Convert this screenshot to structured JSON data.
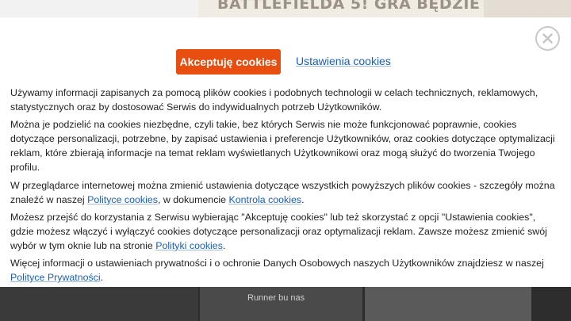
{
  "background": {
    "header_banner_text": "BATTLEFIELDA 5! GRA BĘDZIE",
    "footer_caption": "Runner bu nas"
  },
  "cookie_modal": {
    "accept_label": "Akceptuję cookies",
    "settings_label": "Ustawienia cookies",
    "close_icon": "close-icon",
    "p1": "Używamy informacji zapisanych za pomocą plików cookies i podobnych technologii w celach technicznych, reklamowych, statystycznych oraz by dostosować Serwis do indywidualnych potrzeb Użytkowników.",
    "p2": "Można je podzielić na cookies niezbędne, czyli takie, bez których Serwis nie może funkcjonować poprawnie, cookies dotyczące personalizacji, potrzebne, by zapisać ustawienia i preferencje Użytkowników, oraz cookies dotyczące optymalizacji reklam, które zbierają informacje na temat reklam wyświetlanych Użytkownikowi oraz mogą służyć do tworzenia Twojego profilu.",
    "p3": {
      "before": "W przeglądarce internetowej można zmienić ustawienia dotyczące wszystkich powyższych plików cookies - szczegóły można znaleźć w naszej ",
      "link1": "Polityce cookies",
      "middle": ", w dokumencie ",
      "link2": "Kontrola cookies",
      "after": "."
    },
    "p4": {
      "before": "Możesz przejść do korzystania z Serwisu wybierając \"Akceptuję cookies\" lub też skorzystać z opcji \"Ustawienia cookies\", gdzie możesz włączyć i wyłączyć cookies dotyczące personalizacji oraz optymalizacji reklam. Zawsze możesz zmienić swój wybór w tym oknie lub na stronie ",
      "link": "Polityki cookies",
      "after": "."
    },
    "p5": {
      "before": "Więcej informacji o ustawieniach prywatności i o ochronie Danych Osobowych naszych Użytkowników znajdziesz w naszej ",
      "link": "Polityce Prywatności",
      "after": "."
    }
  },
  "colors": {
    "accent": "#e84e0f",
    "link": "#1a5fb4",
    "text": "#222222"
  }
}
